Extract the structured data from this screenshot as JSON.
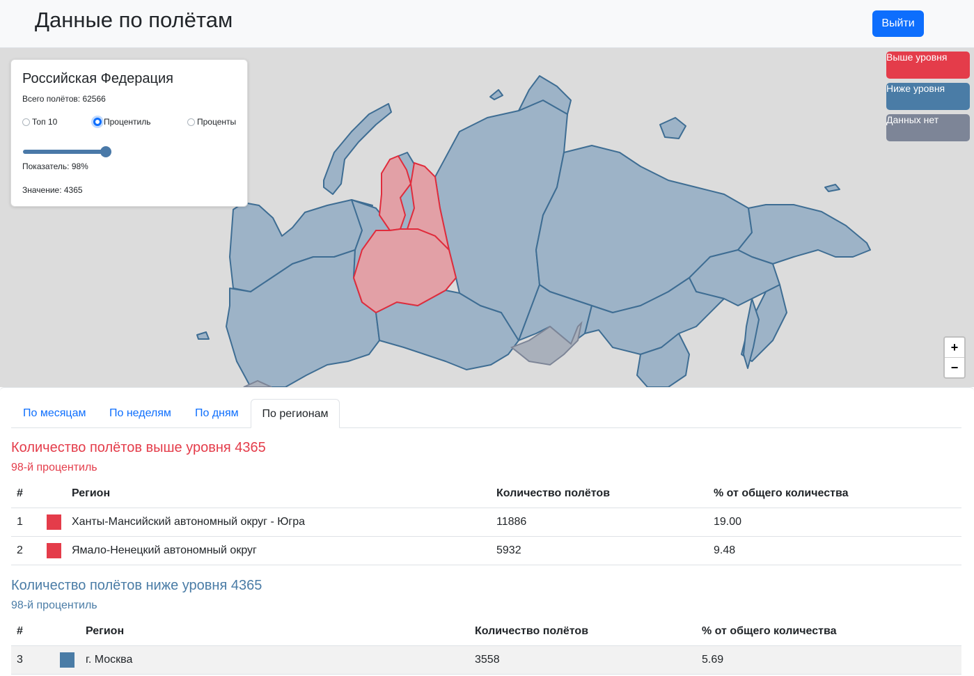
{
  "header": {
    "title": "Данные по полётам",
    "logout_label": "Выйти"
  },
  "info": {
    "title": "Российская Федерация",
    "total_flights": "Всего полётов: 62566",
    "mode_options": [
      "Топ 10",
      "Процентиль",
      "Проценты"
    ],
    "mode_selected": "Процентиль",
    "slider_percent": 98,
    "indicator_text": "Показатель: 98%",
    "value_text": "Значение: 4365"
  },
  "legend": {
    "above_label": "Выше уровня",
    "below_label": "Ниже уровня",
    "nodata_label": "Данных нет",
    "colors": {
      "above": "#e43c4a",
      "below": "#4a7ca6",
      "nodata": "#7d8597"
    }
  },
  "zoom": {
    "in": "+",
    "out": "−"
  },
  "tabs": [
    "По месяцам",
    "По неделям",
    "По дням",
    "По регионам"
  ],
  "active_tab": "По регионам",
  "above": {
    "title": "Количество полётов выше уровня 4365",
    "subtitle": "98-й процентиль",
    "headers": [
      "#",
      "Регион",
      "Количество полётов",
      "% от общего количества"
    ],
    "rows": [
      {
        "num": "1",
        "region": "Ханты-Мансийский автономный округ - Югра",
        "count": "11886",
        "percent": "19.00"
      },
      {
        "num": "2",
        "region": "Ямало-Ненецкий автономный округ",
        "count": "5932",
        "percent": "9.48"
      }
    ]
  },
  "below": {
    "title": "Количество полётов ниже уровня 4365",
    "subtitle": "98-й процентиль",
    "headers": [
      "#",
      "Регион",
      "Количество полётов",
      "% от общего количества"
    ],
    "rows": [
      {
        "num": "3",
        "region": "г. Москва",
        "count": "3558",
        "percent": "5.69"
      }
    ]
  }
}
